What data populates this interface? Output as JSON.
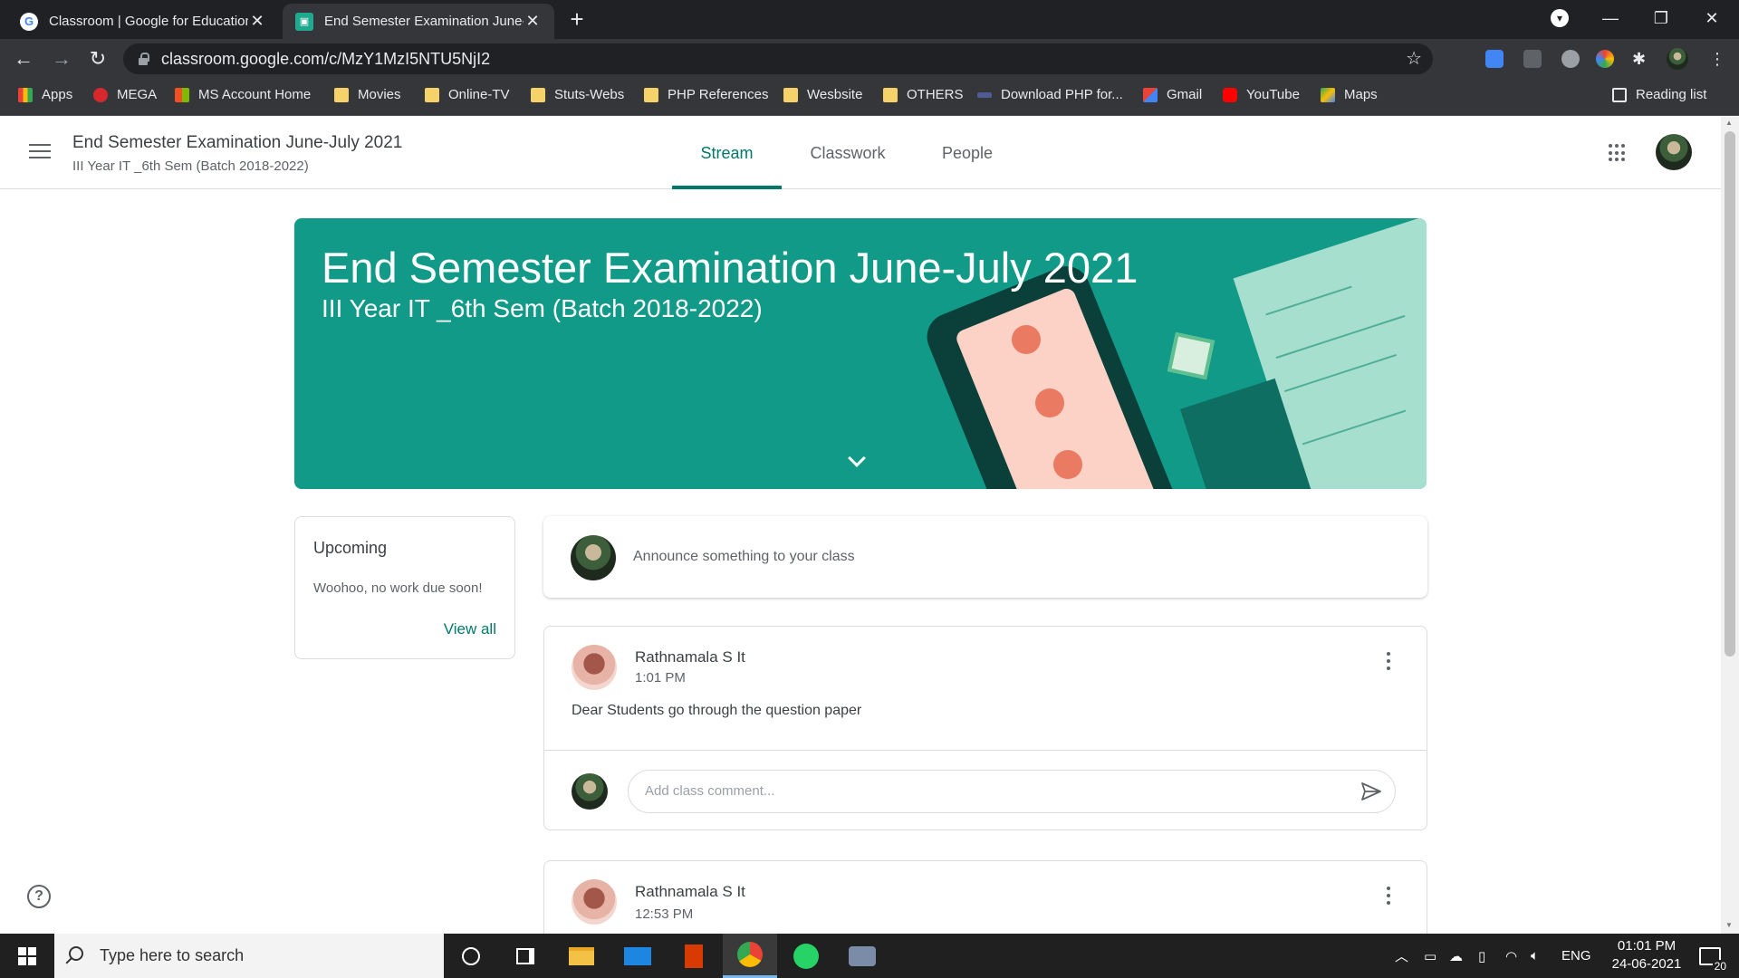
{
  "browser": {
    "tabs": [
      {
        "title": "Classroom | Google for Education",
        "active": false
      },
      {
        "title": "End Semester Examination June-July 2021",
        "active": true
      }
    ],
    "url": "classroom.google.com/c/MzY1MzI5NTU5NjI2",
    "bookmarks": [
      {
        "label": "Apps",
        "icon": "apps-grid-icon"
      },
      {
        "label": "MEGA",
        "icon": "mega-icon"
      },
      {
        "label": "MS Account Home",
        "icon": "microsoft-icon"
      },
      {
        "label": "Movies",
        "icon": "folder-icon"
      },
      {
        "label": "Online-TV",
        "icon": "folder-icon"
      },
      {
        "label": "Stuts-Webs",
        "icon": "folder-icon"
      },
      {
        "label": "PHP References",
        "icon": "folder-icon"
      },
      {
        "label": "Wesbsite",
        "icon": "folder-icon"
      },
      {
        "label": "OTHERS",
        "icon": "folder-icon"
      },
      {
        "label": "Download PHP for...",
        "icon": "php-icon"
      },
      {
        "label": "Gmail",
        "icon": "gmail-icon"
      },
      {
        "label": "YouTube",
        "icon": "youtube-icon"
      },
      {
        "label": "Maps",
        "icon": "maps-icon"
      }
    ],
    "reading_list": "Reading list"
  },
  "classroom": {
    "class_title": "End Semester Examination June-July 2021",
    "class_subtitle": "III Year IT _6th Sem (Batch 2018-2022)",
    "tabs": [
      {
        "label": "Stream",
        "active": true
      },
      {
        "label": "Classwork",
        "active": false
      },
      {
        "label": "People",
        "active": false
      }
    ],
    "banner": {
      "title": "End Semester Examination June-July 2021",
      "subtitle": "III Year IT _6th Sem (Batch 2018-2022)"
    },
    "upcoming": {
      "heading": "Upcoming",
      "text": "Woohoo, no work due soon!",
      "link": "View all"
    },
    "announce_placeholder": "Announce something to your class",
    "posts": [
      {
        "author": "Rathnamala S It",
        "time": "1:01 PM",
        "body": "Dear Students go through the question paper",
        "comment_placeholder": "Add class comment..."
      },
      {
        "author": "Rathnamala S It",
        "time": "12:53 PM"
      }
    ],
    "accent_color": "#00796b",
    "banner_color": "#129a88"
  },
  "taskbar": {
    "search_placeholder": "Type here to search",
    "language": "ENG",
    "time": "01:01 PM",
    "date": "24-06-2021",
    "notification_count": "20"
  }
}
